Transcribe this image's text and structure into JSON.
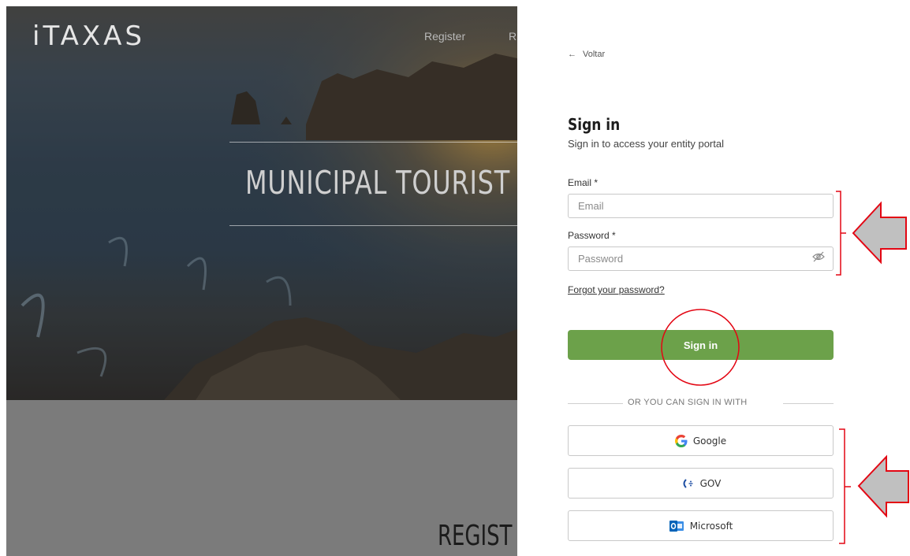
{
  "background_page": {
    "logo": "iTAXAS",
    "nav_register": "Register",
    "nav_partial": "R",
    "hero_title": "MUNICIPAL TOURIST",
    "register_heading": "REGIST"
  },
  "panel": {
    "back_label": "Voltar",
    "title": "Sign in",
    "subtitle": "Sign in to access your entity portal",
    "email": {
      "label": "Email *",
      "placeholder": "Email"
    },
    "password": {
      "label": "Password *",
      "placeholder": "Password"
    },
    "forgot_label": "Forgot your password?",
    "signin_button": "Sign in",
    "divider_text": "OR YOU CAN SIGN IN WITH",
    "providers": [
      {
        "label": "Google",
        "icon": "google-icon"
      },
      {
        "label": "GOV",
        "icon": "gov-icon"
      },
      {
        "label": "Microsoft",
        "icon": "outlook-icon"
      }
    ]
  },
  "colors": {
    "primary_button": "#6ca14a",
    "annotation_red": "#e30613",
    "annotation_arrow_fill": "#c0c0c0"
  }
}
